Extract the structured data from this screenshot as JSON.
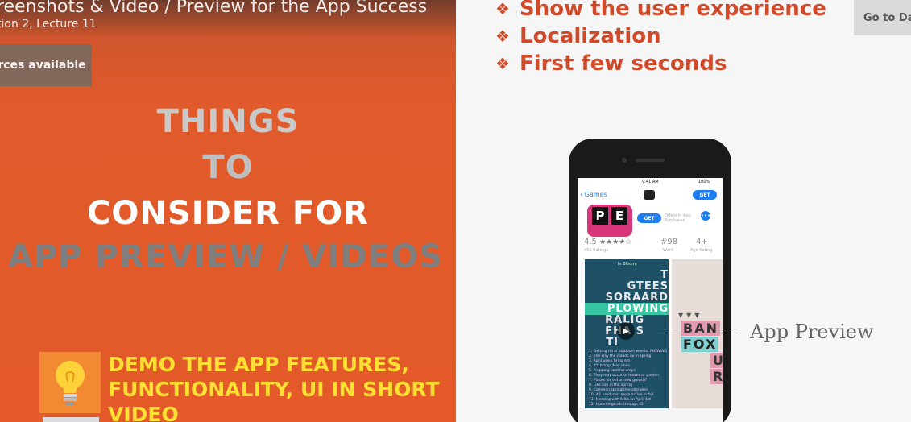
{
  "header": {
    "lecture_title": "reenshots & Video / Preview for the App Success",
    "lecture_subtitle": "tion 2, Lecture 11",
    "resources_button": "rces available",
    "go_to_dashboard": "Go to Da"
  },
  "left_slide": {
    "line1": "THINGS",
    "line2": "TO",
    "line3": "CONSIDER FOR",
    "line4": "APP PREVIEW / VIDEOS",
    "tip_icon": "lightbulb-icon",
    "tip_text": "DEMO THE APP FEATURES, FUNCTIONALITY, UI IN SHORT VIDEO"
  },
  "right_slide": {
    "bullets": [
      "Show the user experience",
      "Localization",
      "First few seconds"
    ],
    "bullet_icon": "diamond-bullet-icon",
    "annotation": "App Preview"
  },
  "phone": {
    "status_time": "9:41 AM",
    "status_battery": "100%",
    "back_label": "Games",
    "get_label": "GET",
    "iap_note": "Offers In-App Purchases",
    "app_letters": [
      "P",
      "E"
    ],
    "rating_value": "4.5",
    "rating_stars": "★★★★☆",
    "rating_count": "451 Ratings",
    "rank_value": "#98",
    "rank_label": "Word",
    "age_value": "4+",
    "age_label": "Age Rating",
    "puzzle_header": "In Bloom",
    "words": [
      "T",
      "GTEES",
      "SORAARD",
      "PLOWING",
      "RALIG",
      "FHA S",
      "TI"
    ],
    "clues": [
      "1. Getting rid of stubborn weeds: PLOWING",
      "2. The way the clouds go in spring",
      "3. April users bring em",
      "4. It'll brings May ones",
      "5. Prepping land for crops",
      "6. They may occur to leaves or garden",
      "7. Places for old or new growth?",
      "8. Like sun in the spring",
      "9. Common springtime allergens",
      "10. #1 producer, more active in fall",
      "11. Messing with folks on April 1st",
      "12. Hummingbirds through 42"
    ],
    "second_shot_rows": [
      "BAN",
      "FOX",
      "U",
      "R"
    ],
    "colors": {
      "accent": "#1c7cf2",
      "app_icon": "#d8357a",
      "puzzle_bg": "#1e5066",
      "highlight": "#38c6a2"
    }
  },
  "colors": {
    "slide_orange": "#e45a29",
    "bullet_red": "#d04a2a",
    "tip_yellow": "#ffe033"
  }
}
